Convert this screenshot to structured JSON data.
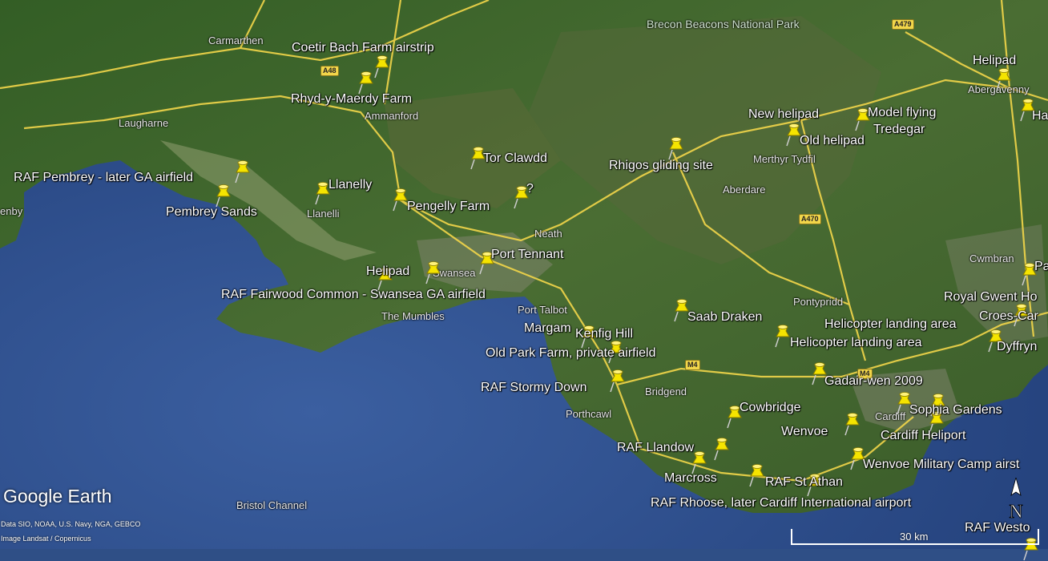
{
  "map": {
    "type": "satellite",
    "places": {
      "carmarthen": "Carmarthen",
      "laugharne": "Laugharne",
      "ammanford": "Ammanford",
      "llanelli": "Llanelli",
      "neath": "Neath",
      "swansea": "Swansea",
      "the_mumbles": "The Mumbles",
      "port_talbot": "Port Talbot",
      "porthcawl": "Porthcawl",
      "bridgend": "Bridgend",
      "aberdare": "Aberdare",
      "merthyr_tydfil": "Merthyr Tydfil",
      "pontypridd": "Pontypridd",
      "abergavenny": "Abergavenny",
      "cwmbran": "Cwmbran",
      "cardiff": "Cardiff",
      "bristol_channel": "Bristol Channel",
      "brecon_beacons": "Brecon Beacons National Park",
      "left_edge": "enby"
    },
    "roads": [
      "A48",
      "A479",
      "M4",
      "A470",
      "M4"
    ],
    "placemarks": [
      "Coetir Bach Farm airstrip",
      "Rhyd-y-Maerdy Farm",
      "RAF Pembrey - later GA airfield",
      "Pembrey Sands",
      "Llanelly",
      "Pengelly Farm",
      "Tor Clawdd",
      "?",
      "Port Tennant",
      "Helipad",
      "RAF Fairwood Common - Swansea GA airfield",
      "Margam",
      "Kenfig Hill",
      "Old Park Farm, private airfield",
      "RAF Stormy Down",
      "Rhigos gliding site",
      "Saab Draken",
      "New helipad",
      "Old helipad",
      "Model flying",
      "Tredegar",
      "Helipad",
      "Ha",
      "Pa",
      "Royal Gwent Ho",
      "Croes-Car",
      "Helicopter landing area",
      "Helicopter landing area",
      "Dyffryn",
      "Gadair-wen 2009",
      "Sophia Gardens",
      "Cardiff Heliport",
      "Cowbridge",
      "Wenvoe",
      "Wenvoe Military Camp airst",
      "RAF Llandow",
      "Marcross",
      "RAF St Athan",
      "RAF Rhoose, later Cardiff International airport",
      "RAF Westo"
    ]
  },
  "branding": {
    "logo": "Google Earth",
    "attribution_line1": "Data SIO, NOAA, U.S. Navy, NGA, GEBCO",
    "attribution_line2": "Image Landsat / Copernicus"
  },
  "scale": {
    "label": "30 km"
  },
  "compass": {
    "label": "N"
  },
  "colors": {
    "sea": "#2f4f86",
    "land": "#3f6b2c",
    "road": "#f2d64a",
    "pin": "#f5e400"
  }
}
